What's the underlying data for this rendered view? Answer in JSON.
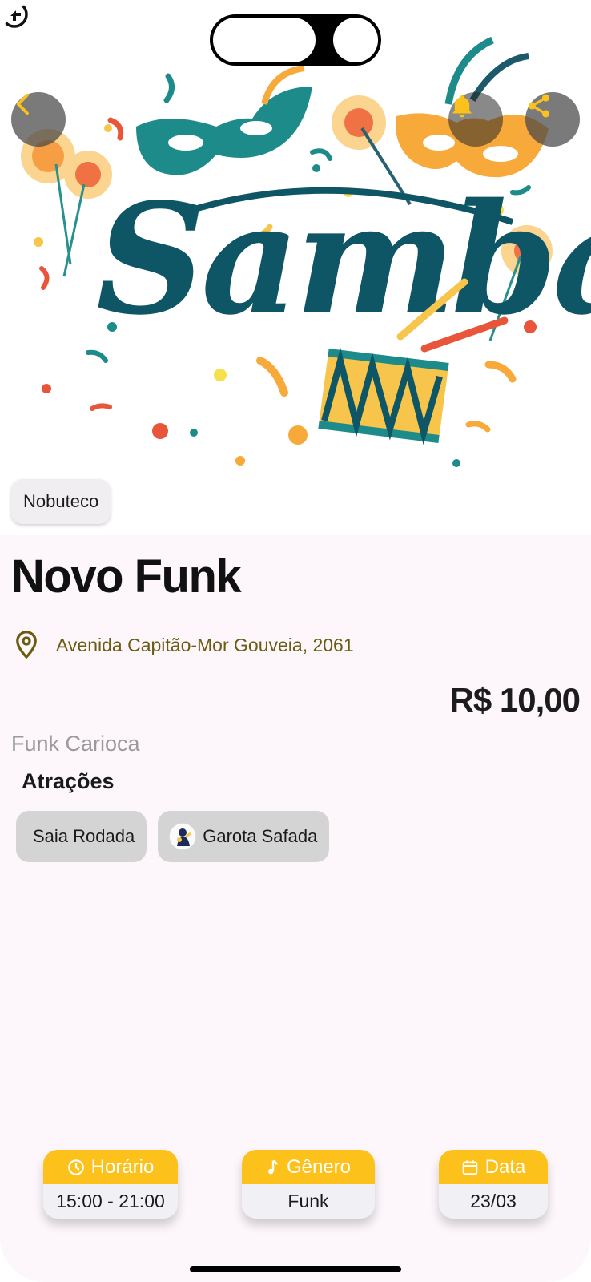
{
  "hero": {
    "image_label": "Samba",
    "venue": "Nobuteco"
  },
  "event": {
    "title": "Novo Funk",
    "address": "Avenida Capitão-Mor Gouveia, 2061",
    "price": "R$ 10,00",
    "genre": "Funk Carioca"
  },
  "attractions": {
    "title": "Atrações",
    "items": [
      {
        "name": "Saia Rodada"
      },
      {
        "name": "Garota Safada"
      }
    ]
  },
  "info": {
    "time": {
      "label": "Horário",
      "value": "15:00 - 21:00"
    },
    "genre": {
      "label": "Gênero",
      "value": "Funk"
    },
    "date": {
      "label": "Data",
      "value": "23/03"
    }
  },
  "colors": {
    "accent": "#fcc21b",
    "address": "#6b5a10",
    "background": "#fdf7fb",
    "chip": "#d4d4d4"
  },
  "icons": [
    "chevron-left-icon",
    "bell-icon",
    "share-icon",
    "plus-circle-icon",
    "map-pin-icon",
    "clock-icon",
    "music-note-icon",
    "calendar-icon"
  ]
}
